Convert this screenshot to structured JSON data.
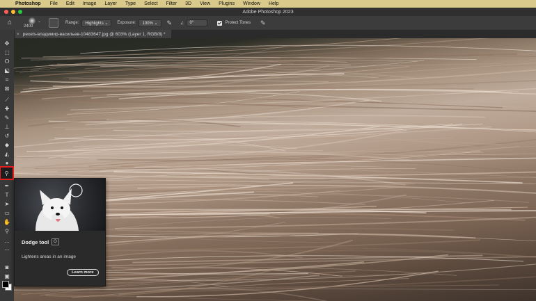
{
  "menubar": {
    "app_name": "Photoshop",
    "items": [
      "File",
      "Edit",
      "Image",
      "Layer",
      "Type",
      "Select",
      "Filter",
      "3D",
      "View",
      "Plugins",
      "Window",
      "Help"
    ]
  },
  "window": {
    "title": "Adobe Photoshop 2023"
  },
  "options": {
    "brush_size": "2400",
    "range_label": "Range:",
    "range_value": "Highlights",
    "exposure_label": "Exposure:",
    "exposure_value": "100%",
    "angle_value": "0°",
    "protect_tones_label": "Protect Tones",
    "protect_tones_checked": true
  },
  "document": {
    "tab_title": "pexels-владимир-васильев-10483647.jpg @ 603% (Layer 1, RGB/8) *"
  },
  "toolbar": {
    "active_tool": "dodge-tool",
    "tools": [
      "move",
      "marquee",
      "lasso",
      "object-selection",
      "crop",
      "frame",
      "eyedropper",
      "healing-brush",
      "brush",
      "clone-stamp",
      "history-brush",
      "eraser",
      "gradient",
      "blur",
      "dodge",
      "pen",
      "type",
      "path-selection",
      "rectangle",
      "hand",
      "zoom",
      "more",
      "colors",
      "quick-mask",
      "screen-mode"
    ]
  },
  "tooltip": {
    "title": "Dodge tool",
    "shortcut": "O",
    "description": "Lightens areas in an image",
    "learn_more": "Learn more"
  },
  "colors": {
    "menubar": "#d9c98a",
    "highlight": "#e81e1e",
    "foreground": "#000000",
    "background": "#ffffff"
  }
}
